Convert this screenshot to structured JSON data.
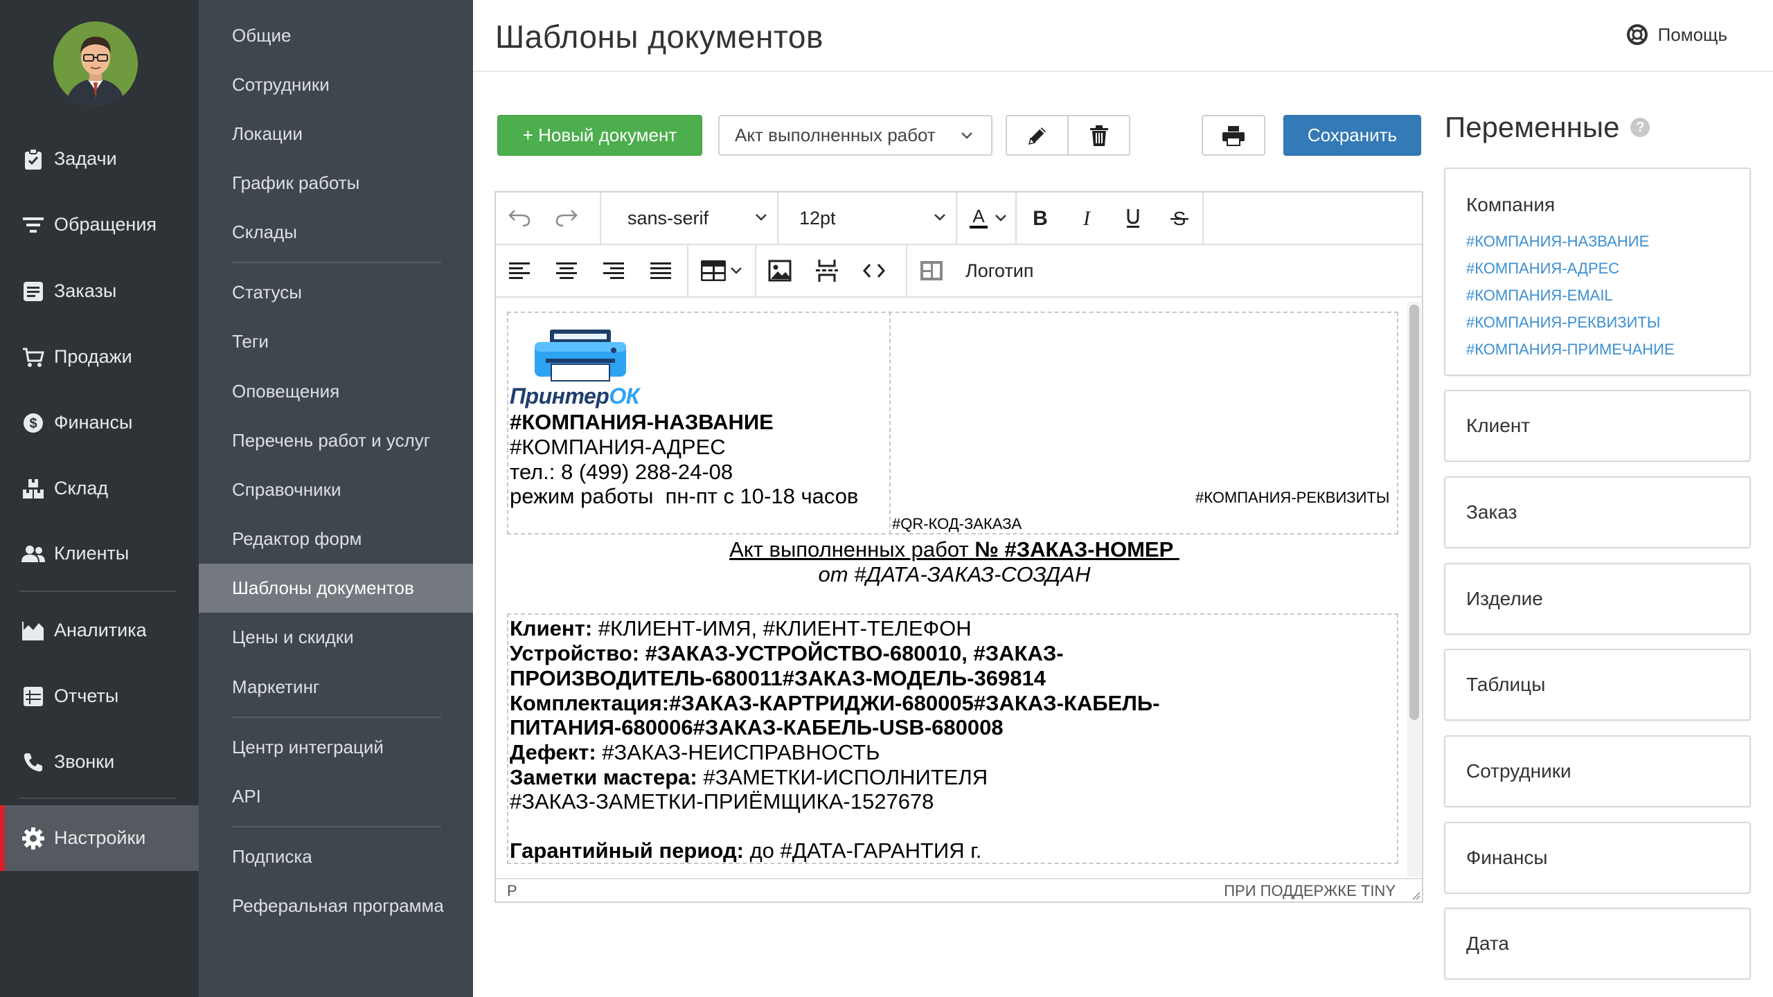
{
  "nav": {
    "items": [
      {
        "label": "Задачи",
        "icon": "clipboard-check-icon"
      },
      {
        "label": "Обращения",
        "icon": "filter-lines-icon"
      },
      {
        "label": "Заказы",
        "icon": "list-box-icon"
      },
      {
        "label": "Продажи",
        "icon": "cart-icon"
      },
      {
        "label": "Финансы",
        "icon": "dollar-circle-icon"
      },
      {
        "label": "Склад",
        "icon": "boxes-icon"
      },
      {
        "label": "Клиенты",
        "icon": "users-icon"
      },
      {
        "label": "Аналитика",
        "icon": "area-chart-icon"
      },
      {
        "label": "Отчеты",
        "icon": "table-list-icon"
      },
      {
        "label": "Звонки",
        "icon": "phone-icon"
      },
      {
        "label": "Настройки",
        "icon": "gear-icon"
      }
    ],
    "active": "Настройки"
  },
  "settings_nav": {
    "items": [
      "Общие",
      "Сотрудники",
      "Локации",
      "График работы",
      "Склады",
      "Статусы",
      "Теги",
      "Оповещения",
      "Перечень работ и услуг",
      "Справочники",
      "Редактор форм",
      "Шаблоны документов",
      "Цены и скидки",
      "Маркетинг",
      "Центр интеграций",
      "API",
      "Подписка",
      "Реферальная программа"
    ],
    "active": "Шаблоны документов"
  },
  "header": {
    "title": "Шаблоны документов",
    "help_label": "Помощь"
  },
  "toolbar": {
    "new_document_label": "+ Новый документ",
    "selected_template": "Акт выполненных работ",
    "save_label": "Сохранить"
  },
  "editor": {
    "font_family": "sans-serif",
    "font_size": "12pt",
    "logo_label": "Логотип",
    "status_path": "P",
    "branding": "ПРИ ПОДДЕРЖКЕ TINY",
    "logo_text_dark": "Принтер",
    "logo_text_accent": "ОК",
    "brand_colors": {
      "dark": "#1f3d6e",
      "accent": "#2ea3f2"
    },
    "doc": {
      "company_name": "#КОМПАНИЯ-НАЗВАНИЕ",
      "company_address": "#КОМПАНИЯ-АДРЕС",
      "phone": "тел.: 8 (499) 288-24-08",
      "hours": "режим работы  пн-пт с 10-18 часов",
      "qr_code": "#QR-КОД-ЗАКАЗА",
      "company_requisites": "#КОМПАНИЯ-РЕКВИЗИТЫ",
      "act_title": "Акт выполненных работ",
      "act_number": "№ #ЗАКАЗ-НОМЕР",
      "act_date": "от #ДАТА-ЗАКАЗ-СОЗДАН",
      "client_label": "Клиент:",
      "client_value": " #КЛИЕНТ-ИМЯ, #КЛИЕНТ-ТЕЛЕФОН",
      "device_line1": "Устройство: #ЗАКАЗ-УСТРОЙСТВО-680010, #ЗАКАЗ-",
      "device_line2": "ПРОИЗВОДИТЕЛЬ-680011#ЗАКАЗ-МОДЕЛЬ-369814",
      "kit_line1": "Комплектация:#ЗАКАЗ-КАРТРИДЖИ-680005#ЗАКАЗ-КАБЕЛЬ-",
      "kit_line2": "ПИТАНИЯ-680006#ЗАКАЗ-КАБЕЛЬ-USB-680008",
      "defect_label": "Дефект:",
      "defect_value": " #ЗАКАЗ-НЕИСПРАВНОСТЬ",
      "notes_label": "Заметки мастера:",
      "notes_value": " #ЗАМЕТКИ-ИСПОЛНИТЕЛЯ",
      "notes_line2": "#ЗАКАЗ-ЗАМЕТКИ-ПРИЁМЩИКА-1527678",
      "warranty_label": "Гарантийный период:",
      "warranty_value": " до #ДАТА-ГАРАНТИЯ г."
    }
  },
  "variables": {
    "title": "Переменные",
    "groups": [
      {
        "title": "Компания",
        "items": [
          "#КОМПАНИЯ-НАЗВАНИЕ",
          "#КОМПАНИЯ-АДРЕС",
          "#КОМПАНИЯ-EMAIL",
          "#КОМПАНИЯ-РЕКВИЗИТЫ",
          "#КОМПАНИЯ-ПРИМЕЧАНИЕ"
        ]
      },
      {
        "title": "Клиент"
      },
      {
        "title": "Заказ"
      },
      {
        "title": "Изделие"
      },
      {
        "title": "Таблицы"
      },
      {
        "title": "Сотрудники"
      },
      {
        "title": "Финансы"
      },
      {
        "title": "Дата"
      }
    ],
    "link_color": "#3d8fd1"
  }
}
